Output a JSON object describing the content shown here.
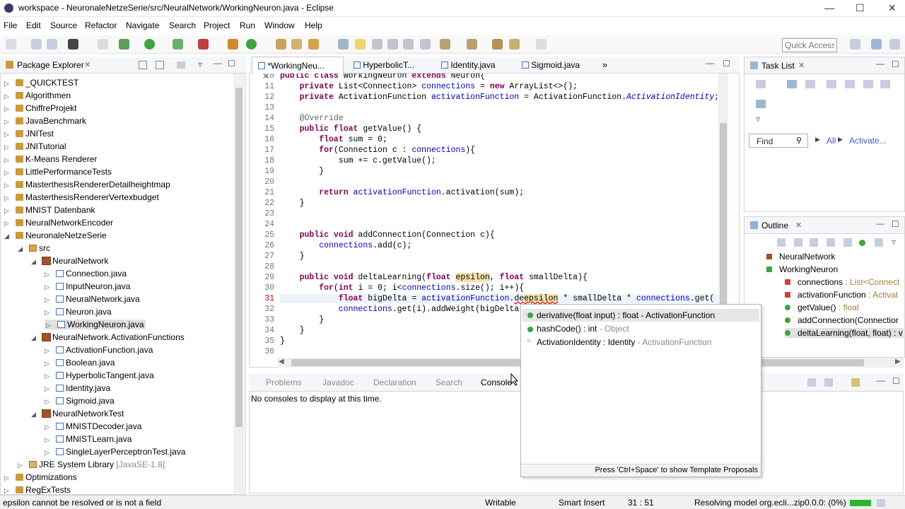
{
  "window": {
    "title": "workspace - NeuronaleNetzeSerie/src/NeuralNetwork/WorkingNeuron.java - Eclipse"
  },
  "menu": [
    "File",
    "Edit",
    "Source",
    "Refactor",
    "Navigate",
    "Search",
    "Project",
    "Run",
    "Window",
    "Help"
  ],
  "toolbar": {
    "quick_access": "Quick Access"
  },
  "package_explorer": {
    "title": "Package Explorer",
    "items": [
      {
        "label": "_QUICKTEST",
        "type": "project",
        "depth": 0,
        "twisty": "closed"
      },
      {
        "label": "Algorithmen",
        "type": "project",
        "depth": 0,
        "twisty": "closed"
      },
      {
        "label": "ChiffreProjekt",
        "type": "project",
        "depth": 0,
        "twisty": "closed"
      },
      {
        "label": "JavaBenchmark",
        "type": "project",
        "depth": 0,
        "twisty": "closed"
      },
      {
        "label": "JNITest",
        "type": "project",
        "depth": 0,
        "twisty": "closed"
      },
      {
        "label": "JNITutorial",
        "type": "project",
        "depth": 0,
        "twisty": "closed"
      },
      {
        "label": "K-Means Renderer",
        "type": "project",
        "depth": 0,
        "twisty": "closed"
      },
      {
        "label": "LittlePerformanceTests",
        "type": "project",
        "depth": 0,
        "twisty": "closed"
      },
      {
        "label": "MasterthesisRendererDetailheightmap",
        "type": "project",
        "depth": 0,
        "twisty": "closed"
      },
      {
        "label": "MasterthesisRendererVertexbudget",
        "type": "project",
        "depth": 0,
        "twisty": "closed"
      },
      {
        "label": "MNIST Datenbank",
        "type": "project",
        "depth": 0,
        "twisty": "closed"
      },
      {
        "label": "NeuralNetworkEncoder",
        "type": "project",
        "depth": 0,
        "twisty": "closed"
      },
      {
        "label": "NeuronaleNetzeSerie",
        "type": "project",
        "depth": 0,
        "twisty": "open"
      },
      {
        "label": "src",
        "type": "src",
        "depth": 1,
        "twisty": "open"
      },
      {
        "label": "NeuralNetwork",
        "type": "package",
        "depth": 2,
        "twisty": "open"
      },
      {
        "label": "Connection.java",
        "type": "file",
        "depth": 3,
        "twisty": "closed"
      },
      {
        "label": "InputNeuron.java",
        "type": "file",
        "depth": 3,
        "twisty": "closed"
      },
      {
        "label": "NeuralNetwork.java",
        "type": "file",
        "depth": 3,
        "twisty": "closed"
      },
      {
        "label": "Neuron.java",
        "type": "file",
        "depth": 3,
        "twisty": "closed"
      },
      {
        "label": "WorkingNeuron.java",
        "type": "file",
        "depth": 3,
        "twisty": "closed",
        "selected": true
      },
      {
        "label": "NeuralNetwork.ActivationFunctions",
        "type": "package",
        "depth": 2,
        "twisty": "open"
      },
      {
        "label": "ActivationFunction.java",
        "type": "file",
        "depth": 3,
        "twisty": "closed"
      },
      {
        "label": "Boolean.java",
        "type": "file",
        "depth": 3,
        "twisty": "closed"
      },
      {
        "label": "HyperbolicTangent.java",
        "type": "file",
        "depth": 3,
        "twisty": "closed"
      },
      {
        "label": "Identity.java",
        "type": "file",
        "depth": 3,
        "twisty": "closed"
      },
      {
        "label": "Sigmoid.java",
        "type": "file",
        "depth": 3,
        "twisty": "closed"
      },
      {
        "label": "NeuralNetworkTest",
        "type": "package",
        "depth": 2,
        "twisty": "open"
      },
      {
        "label": "MNISTDecoder.java",
        "type": "file",
        "depth": 3,
        "twisty": "closed"
      },
      {
        "label": "MNISTLearn.java",
        "type": "file",
        "depth": 3,
        "twisty": "closed"
      },
      {
        "label": "SingleLayerPerceptronTest.java",
        "type": "file",
        "depth": 3,
        "twisty": "closed"
      },
      {
        "label": "JRE System Library",
        "suffix": "[JavaSE-1.8]",
        "type": "library",
        "depth": 1,
        "twisty": "closed"
      },
      {
        "label": "Optimizations",
        "type": "project",
        "depth": 0,
        "twisty": "closed"
      },
      {
        "label": "RegExTests",
        "type": "project",
        "depth": 0,
        "twisty": "closed"
      }
    ]
  },
  "editor": {
    "tabs": [
      {
        "label": "*WorkingNeu...",
        "active": true
      },
      {
        "label": "HyperbolicT..."
      },
      {
        "label": "Identity.java"
      },
      {
        "label": "Sigmoid.java"
      }
    ],
    "overflow": "»",
    "lines": [
      {
        "n": "10",
        "html": "<span class=\"kw\">public class</span> WorkingNeuron <span class=\"kw\">extends</span> Neuron{"
      },
      {
        "n": "11",
        "html": "    <span class=\"kw\">private</span> List&lt;Connection&gt; <span class=\"fld\">connections</span> = <span class=\"kw\">new</span> ArrayList&lt;&gt;();"
      },
      {
        "n": "12",
        "html": "    <span class=\"kw\">private</span> ActivationFunction <span class=\"fld\">activationFunction</span> = ActivationFunction.<span class=\"it\">ActivationIdentity</span>;"
      },
      {
        "n": "13",
        "html": ""
      },
      {
        "n": "14",
        "html": "    <span class=\"ann\">@Override</span>"
      },
      {
        "n": "15",
        "html": "    <span class=\"kw\">public float</span> getValue() {"
      },
      {
        "n": "16",
        "html": "        <span class=\"kw\">float</span> sum = 0;"
      },
      {
        "n": "17",
        "html": "        <span class=\"kw\">for</span>(Connection c : <span class=\"fld\">connections</span>){"
      },
      {
        "n": "18",
        "html": "            sum += c.getValue();"
      },
      {
        "n": "19",
        "html": "        }"
      },
      {
        "n": "20",
        "html": ""
      },
      {
        "n": "21",
        "html": "        <span class=\"kw\">return</span> <span class=\"fld\">activationFunction</span>.activation(sum);"
      },
      {
        "n": "22",
        "html": "    }"
      },
      {
        "n": "23",
        "html": ""
      },
      {
        "n": "24",
        "html": ""
      },
      {
        "n": "25",
        "html": "    <span class=\"kw\">public void</span> addConnection(Connection c){"
      },
      {
        "n": "26",
        "html": "        <span class=\"fld\">connections</span>.add(c);"
      },
      {
        "n": "27",
        "html": "    }"
      },
      {
        "n": "28",
        "html": ""
      },
      {
        "n": "29",
        "html": "    <span class=\"kw\">public void</span> deltaLearning(<span class=\"kw\">float</span> <span class=\"hl\">epsilon</span>, <span class=\"kw\">float</span> smallDelta){"
      },
      {
        "n": "30",
        "html": "        <span class=\"kw\">for</span>(<span class=\"kw\">int</span> i = 0; i&lt;<span class=\"fld\">connections</span>.size(); i++){"
      },
      {
        "n": "31",
        "html": "            <span class=\"kw\">float</span> bigDelta = <span class=\"fld\">activationFunction</span>.<span class=\"err\">de<span class=\"hl\">epsilon</span></span> * smallDelta * <span class=\"fld\">connections</span>.get("
      },
      {
        "n": "32",
        "html": "            <span class=\"fld\">connections</span>.get(i).addWeight(bigDelta"
      },
      {
        "n": "33",
        "html": "        }"
      },
      {
        "n": "34",
        "html": "    }"
      },
      {
        "n": "35",
        "html": "}"
      },
      {
        "n": "36",
        "html": ""
      }
    ]
  },
  "autocomplete": {
    "items": [
      {
        "name": "derivative(float input) : float - ActivationFunction",
        "extra": "",
        "color": "#3fa33f",
        "selected": true
      },
      {
        "name": "hashCode() : int",
        "extra": " - Object",
        "color": "#3fa33f"
      },
      {
        "name": "ActivationIdentity : Identity",
        "extra": " - ActivationFunction",
        "color": "#6a6a9a"
      }
    ],
    "footer": "Press 'Ctrl+Space' to show Template Proposals"
  },
  "bottom": {
    "tabs": [
      "Problems",
      "Javadoc",
      "Declaration",
      "Search",
      "Console"
    ],
    "message": "No consoles to display at this time."
  },
  "tasklist": {
    "title": "Task List",
    "find_placeholder": "Find",
    "all": "All",
    "activate": "Activate..."
  },
  "outline": {
    "title": "Outline",
    "items": [
      {
        "label": "NeuralNetwork",
        "detail": "",
        "depth": 0,
        "color": "#a0522d"
      },
      {
        "label": "WorkingNeuron",
        "detail": "",
        "depth": 0,
        "color": "#3fa33f",
        "twisty": true
      },
      {
        "label": "connections",
        "detail": " : List<Connect",
        "depth": 1,
        "color": "#d04040"
      },
      {
        "label": "activationFunction",
        "detail": " : Activat",
        "depth": 1,
        "color": "#d04040"
      },
      {
        "label": "getValue()",
        "detail": " : float",
        "depth": 1,
        "color": "#3fa33f"
      },
      {
        "label": "addConnection(Connectior",
        "detail": "",
        "depth": 1,
        "color": "#3fa33f"
      },
      {
        "label": "deltaLearning(float, float) : v",
        "detail": "",
        "depth": 1,
        "color": "#3fa33f",
        "selected": true
      }
    ]
  },
  "status": {
    "message": "epsilon cannot be resolved or is not a field",
    "writable": "Writable",
    "insert": "Smart Insert",
    "position": "31 : 51",
    "progress": "Resolving model org.ecli...zip0.0.0: (0%)"
  }
}
